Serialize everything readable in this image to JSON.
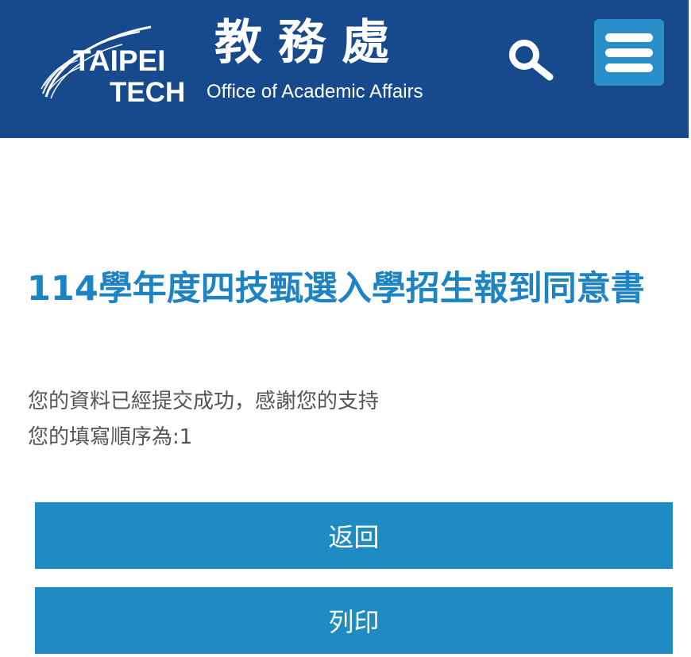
{
  "header": {
    "logo_line1": "TAIPEI",
    "logo_line2": "TECH",
    "office_name_zh": "教務處",
    "office_name_en": "Office of Academic Affairs",
    "search_icon": "search-icon",
    "menu_icon": "hamburger-menu-icon"
  },
  "main": {
    "title": "114學年度四技甄選入學招生報到同意書",
    "message_success": "您的資料已經提交成功，感謝您的支持",
    "message_order": "您的填寫順序為:1"
  },
  "buttons": {
    "back_label": "返回",
    "print_label": "列印"
  },
  "colors": {
    "header_bg": "#174a8c",
    "accent": "#1f8bc3",
    "title": "#1e83c2",
    "menu_bg": "#2a8fc9"
  }
}
